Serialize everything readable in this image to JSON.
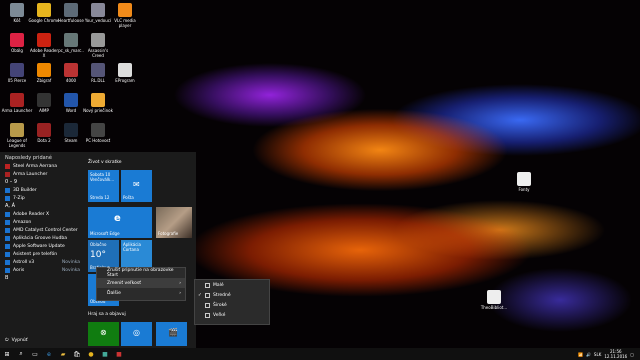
{
  "desktop": {
    "icons": [
      {
        "label": "Kôš",
        "col": 0,
        "row": 0,
        "color": "#7d8a96"
      },
      {
        "label": "Google Chrome",
        "col": 1,
        "row": 0,
        "color": "#e6b41e"
      },
      {
        "label": "Heartfuloose",
        "col": 2,
        "row": 0,
        "color": "#5d6a77"
      },
      {
        "label": "Your_vedoucí",
        "col": 3,
        "row": 0,
        "color": "#889"
      },
      {
        "label": "VLC media player",
        "col": 4,
        "row": 0,
        "color": "#f08a1a"
      },
      {
        "label": "Obálg",
        "col": 0,
        "row": 1,
        "color": "#d24"
      },
      {
        "label": "Adobe Reader X",
        "col": 1,
        "row": 1,
        "color": "#c21"
      },
      {
        "label": "pc_sk_marc..",
        "col": 2,
        "row": 1,
        "color": "#677"
      },
      {
        "label": "Assassin's Creed",
        "col": 3,
        "row": 1,
        "color": "#999"
      },
      {
        "label": "05 Pierce",
        "col": 0,
        "row": 2,
        "color": "#447"
      },
      {
        "label": "Zbigraf",
        "col": 1,
        "row": 2,
        "color": "#e80"
      },
      {
        "label": "4000",
        "col": 2,
        "row": 2,
        "color": "#b33"
      },
      {
        "label": "RL.DLL",
        "col": 3,
        "row": 2,
        "color": "#557"
      },
      {
        "label": "EProgram",
        "col": 4,
        "row": 2,
        "color": "#ddd"
      },
      {
        "label": "Arma Launcher",
        "col": 0,
        "row": 3,
        "color": "#a22"
      },
      {
        "label": "AIMP",
        "col": 1,
        "row": 3,
        "color": "#333"
      },
      {
        "label": "Word",
        "col": 2,
        "row": 3,
        "color": "#2255aa"
      },
      {
        "label": "Nový priečinok",
        "col": 3,
        "row": 3,
        "color": "#eeaa33"
      },
      {
        "label": "League of Legends",
        "col": 0,
        "row": 4,
        "color": "#b89a4a"
      },
      {
        "label": "Dota 2",
        "col": 1,
        "row": 4,
        "color": "#922"
      },
      {
        "label": "Steam",
        "col": 2,
        "row": 4,
        "color": "#1b2838"
      },
      {
        "label": "PC Hotovosť",
        "col": 3,
        "row": 4,
        "color": "#444"
      }
    ],
    "right_icons": [
      {
        "label": "Fonty",
        "color": "#eee"
      },
      {
        "label": "TheoBibliot...",
        "color": "#eee"
      }
    ]
  },
  "start_menu": {
    "recent_header": "Naposledy pridané",
    "recent": [
      {
        "label": "Steel Arma Aerrana"
      },
      {
        "label": "Arma Launcher"
      }
    ],
    "groups": [
      {
        "heading": "0 – 9",
        "apps": [
          {
            "label": "3D Builder",
            "tag": ""
          }
        ]
      },
      {
        "heading": "",
        "apps": [
          {
            "label": "7-Zip",
            "tag": ""
          }
        ]
      },
      {
        "heading": "A, Á",
        "apps": [
          {
            "label": "Adobe Reader X",
            "tag": ""
          },
          {
            "label": "Amazon",
            "tag": ""
          },
          {
            "label": "AMD Catalyst Control Center",
            "tag": ""
          },
          {
            "label": "Aplikácia Groove Hudba",
            "tag": ""
          },
          {
            "label": "Apple Software Update",
            "tag": ""
          },
          {
            "label": "Asistent pre telefón",
            "tag": ""
          },
          {
            "label": "Astroll v3",
            "tag": "Novinka"
          },
          {
            "label": "Aoris",
            "tag": "Novinka"
          }
        ]
      },
      {
        "heading": "B",
        "apps": []
      }
    ],
    "power_label": "Vypnúť",
    "tiles_header": "Život v skratke",
    "play_header": "Hraj sa a objavuj",
    "tiles": {
      "calendar": "Sobota 10 Venčoválk...",
      "calendar_sub": "Streda 12",
      "mail": "Pošta",
      "edge": "Microsoft Edge",
      "photos": "Fotografie",
      "weather_city": "Oblačno",
      "weather_temp": "10°",
      "weather_place": "Bratislava",
      "cortana": "Aplikácia Cortana",
      "store": "Obchod"
    }
  },
  "context_menu": {
    "items": [
      {
        "label": "Zrušiť pripnutie na obrazovke Štart",
        "arrow": false
      },
      {
        "label": "Zmeniť veľkosť",
        "arrow": true
      },
      {
        "label": "Ďalšie",
        "arrow": true
      }
    ]
  },
  "size_menu": {
    "items": [
      {
        "label": "Malé",
        "checked": false
      },
      {
        "label": "Stredné",
        "checked": true
      },
      {
        "label": "Široké",
        "checked": false
      },
      {
        "label": "Veľké",
        "checked": false
      }
    ]
  },
  "taskbar": {
    "time": "21:56",
    "date": "12.11.2016",
    "lang": "SLK"
  }
}
